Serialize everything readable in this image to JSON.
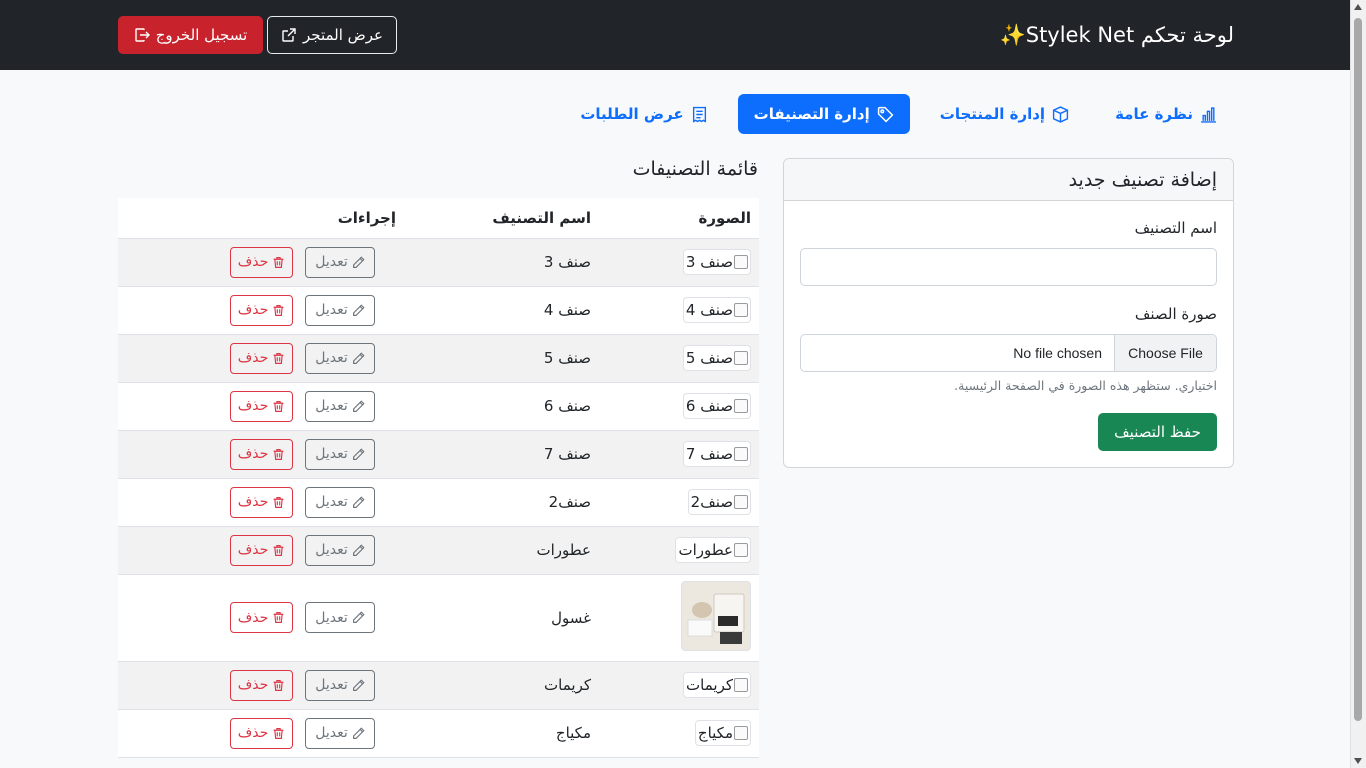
{
  "navbar": {
    "brand_title": "لوحة تحكم Stylek Net",
    "brand_icon": "sparkles-icon",
    "store_button": "عرض المتجر",
    "logout_button": "تسجيل الخروج"
  },
  "tabs": [
    {
      "label": "نظرة عامة",
      "icon": "bar-chart-icon",
      "active": false
    },
    {
      "label": "إدارة المنتجات",
      "icon": "box-icon",
      "active": false
    },
    {
      "label": "إدارة التصنيفات",
      "icon": "tag-icon",
      "active": true
    },
    {
      "label": "عرض الطلبات",
      "icon": "receipt-icon",
      "active": false
    }
  ],
  "form": {
    "title": "إضافة تصنيف جديد",
    "name_label": "اسم التصنيف",
    "name_value": "",
    "image_label": "صورة الصنف",
    "file_button": "Choose File",
    "file_status": "No file chosen",
    "help_text": "اختياري. ستظهر هذه الصورة في الصفحة الرئيسية.",
    "save_button": "حفظ التصنيف"
  },
  "list": {
    "title": "قائمة التصنيفات",
    "columns": {
      "image": "الصورة",
      "name": "اسم التصنيف",
      "actions": "إجراءات"
    },
    "edit_label": "تعديل",
    "delete_label": "حذف",
    "rows": [
      {
        "image_alt": "صنف 3",
        "name": "صنف 3",
        "has_photo": false
      },
      {
        "image_alt": "صنف 4",
        "name": "صنف 4",
        "has_photo": false
      },
      {
        "image_alt": "صنف 5",
        "name": "صنف 5",
        "has_photo": false
      },
      {
        "image_alt": "صنف 6",
        "name": "صنف 6",
        "has_photo": false
      },
      {
        "image_alt": "صنف 7",
        "name": "صنف 7",
        "has_photo": false
      },
      {
        "image_alt": "صنف2",
        "name": "صنف2",
        "has_photo": false
      },
      {
        "image_alt": "عطورات",
        "name": "عطورات",
        "has_photo": false
      },
      {
        "image_alt": "",
        "name": "غسول",
        "has_photo": true
      },
      {
        "image_alt": "كريمات",
        "name": "كريمات",
        "has_photo": false
      },
      {
        "image_alt": "مكياج",
        "name": "مكياج",
        "has_photo": false
      }
    ]
  },
  "colors": {
    "navbar_bg": "#212529",
    "primary": "#0d6efd",
    "danger": "#dc3545",
    "success": "#198754",
    "secondary": "#6c757d"
  }
}
